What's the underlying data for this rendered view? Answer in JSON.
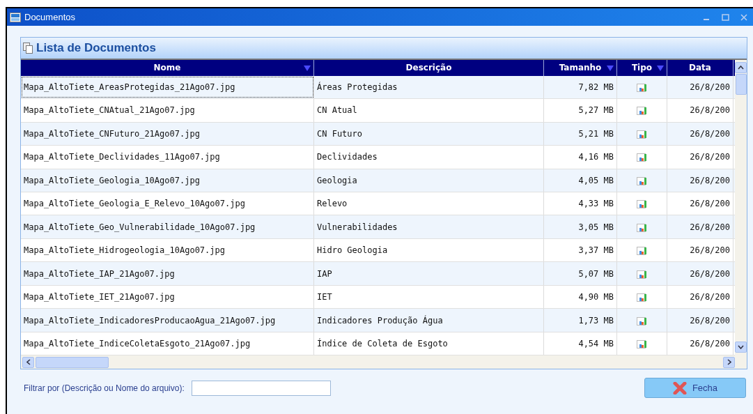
{
  "window": {
    "title": "Documentos"
  },
  "panel": {
    "title": "Lista de Documentos"
  },
  "table": {
    "columns": [
      {
        "label": "Nome",
        "sort_arrow": true
      },
      {
        "label": "Descrição",
        "sort_arrow": false
      },
      {
        "label": "Tamanho",
        "sort_arrow": true
      },
      {
        "label": "Tipo",
        "sort_arrow": true
      },
      {
        "label": "Data",
        "sort_arrow": false
      }
    ],
    "rows": [
      {
        "name": "Mapa_AltoTiete_AreasProtegidas_21Ago07.jpg",
        "description": "Áreas Protegidas",
        "size": "7,82 MB",
        "date": "26/8/200",
        "selected": true
      },
      {
        "name": "Mapa_AltoTiete_CNAtual_21Ago07.jpg",
        "description": "CN Atual",
        "size": "5,27 MB",
        "date": "26/8/200",
        "selected": false
      },
      {
        "name": "Mapa_AltoTiete_CNFuturo_21Ago07.jpg",
        "description": "CN Futuro",
        "size": "5,21 MB",
        "date": "26/8/200",
        "selected": false
      },
      {
        "name": "Mapa_AltoTiete_Declividades_11Ago07.jpg",
        "description": "Declividades",
        "size": "4,16 MB",
        "date": "26/8/200",
        "selected": false
      },
      {
        "name": "Mapa_AltoTiete_Geologia_10Ago07.jpg",
        "description": "Geologia",
        "size": "4,05 MB",
        "date": "26/8/200",
        "selected": false
      },
      {
        "name": "Mapa_AltoTiete_Geologia_E_Relevo_10Ago07.jpg",
        "description": "Relevo",
        "size": "4,33 MB",
        "date": "26/8/200",
        "selected": false
      },
      {
        "name": "Mapa_AltoTiete_Geo_Vulnerabilidade_10Ago07.jpg",
        "description": "Vulnerabilidades",
        "size": "3,05 MB",
        "date": "26/8/200",
        "selected": false
      },
      {
        "name": "Mapa_AltoTiete_Hidrogeologia_10Ago07.jpg",
        "description": "Hidro Geologia",
        "size": "3,37 MB",
        "date": "26/8/200",
        "selected": false
      },
      {
        "name": "Mapa_AltoTiete_IAP_21Ago07.jpg",
        "description": "IAP",
        "size": "5,07 MB",
        "date": "26/8/200",
        "selected": false
      },
      {
        "name": "Mapa_AltoTiete_IET_21Ago07.jpg",
        "description": "IET",
        "size": "4,90 MB",
        "date": "26/8/200",
        "selected": false
      },
      {
        "name": "Mapa_AltoTiete_IndicadoresProducaoAgua_21Ago07.jpg",
        "description": "Indicadores Produção Água",
        "size": "1,73 MB",
        "date": "26/8/200",
        "selected": false
      },
      {
        "name": "Mapa_AltoTiete_IndiceColetaEsgoto_21Ago07.jpg",
        "description": "Índice de Coleta de Esgoto",
        "size": "4,54 MB",
        "date": "26/8/200",
        "selected": false
      }
    ]
  },
  "filter": {
    "label": "Filtrar por (Descrição ou Nome do arquivo):"
  },
  "buttons": [
    {
      "label": "Fecha"
    }
  ]
}
